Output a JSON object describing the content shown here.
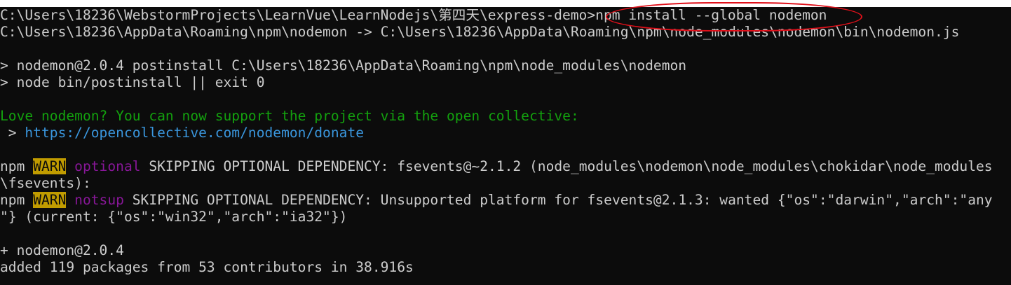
{
  "terminal": {
    "prompt": "C:\\Users\\18236\\WebstormProjects\\LearnVue\\LearnNodejs\\第四天\\express-demo>",
    "command": "npm install --global nodemon",
    "link_line": "C:\\Users\\18236\\AppData\\Roaming\\npm\\nodemon -> C:\\Users\\18236\\AppData\\Roaming\\npm\\node_modules\\nodemon\\bin\\nodemon.js",
    "postinstall_line": "> nodemon@2.0.4 postinstall C:\\Users\\18236\\AppData\\Roaming\\npm\\node_modules\\nodemon",
    "node_line": "> node bin/postinstall || exit 0",
    "love_line": "Love nodemon? You can now support the project via the open collective:",
    "donate_prefix": " > ",
    "donate_url": "https://opencollective.com/nodemon/donate",
    "warn1": {
      "npm": "npm ",
      "level": "WARN",
      "tag": " optional",
      "message": " SKIPPING OPTIONAL DEPENDENCY: fsevents@~2.1.2 (node_modules\\nodemon\\node_modules\\chokidar\\node_modules",
      "continuation": "\\fsevents):"
    },
    "warn2": {
      "npm": "npm ",
      "level": "WARN",
      "tag": " notsup",
      "message": " SKIPPING OPTIONAL DEPENDENCY: Unsupported platform for fsevents@2.1.3: wanted {\"os\":\"darwin\",\"arch\":\"any",
      "continuation": "\"} (current: {\"os\":\"win32\",\"arch\":\"ia32\"})"
    },
    "installed_line": "+ nodemon@2.0.4",
    "summary_line": "added 119 packages from 53 contributors in 38.916s"
  },
  "colors": {
    "background": "#0c0c0c",
    "text": "#cccccc",
    "green": "#13a10e",
    "cyan": "#3a96dd",
    "magenta": "#881798",
    "warn_bg": "#c19c00",
    "annotation": "#e0101a"
  }
}
